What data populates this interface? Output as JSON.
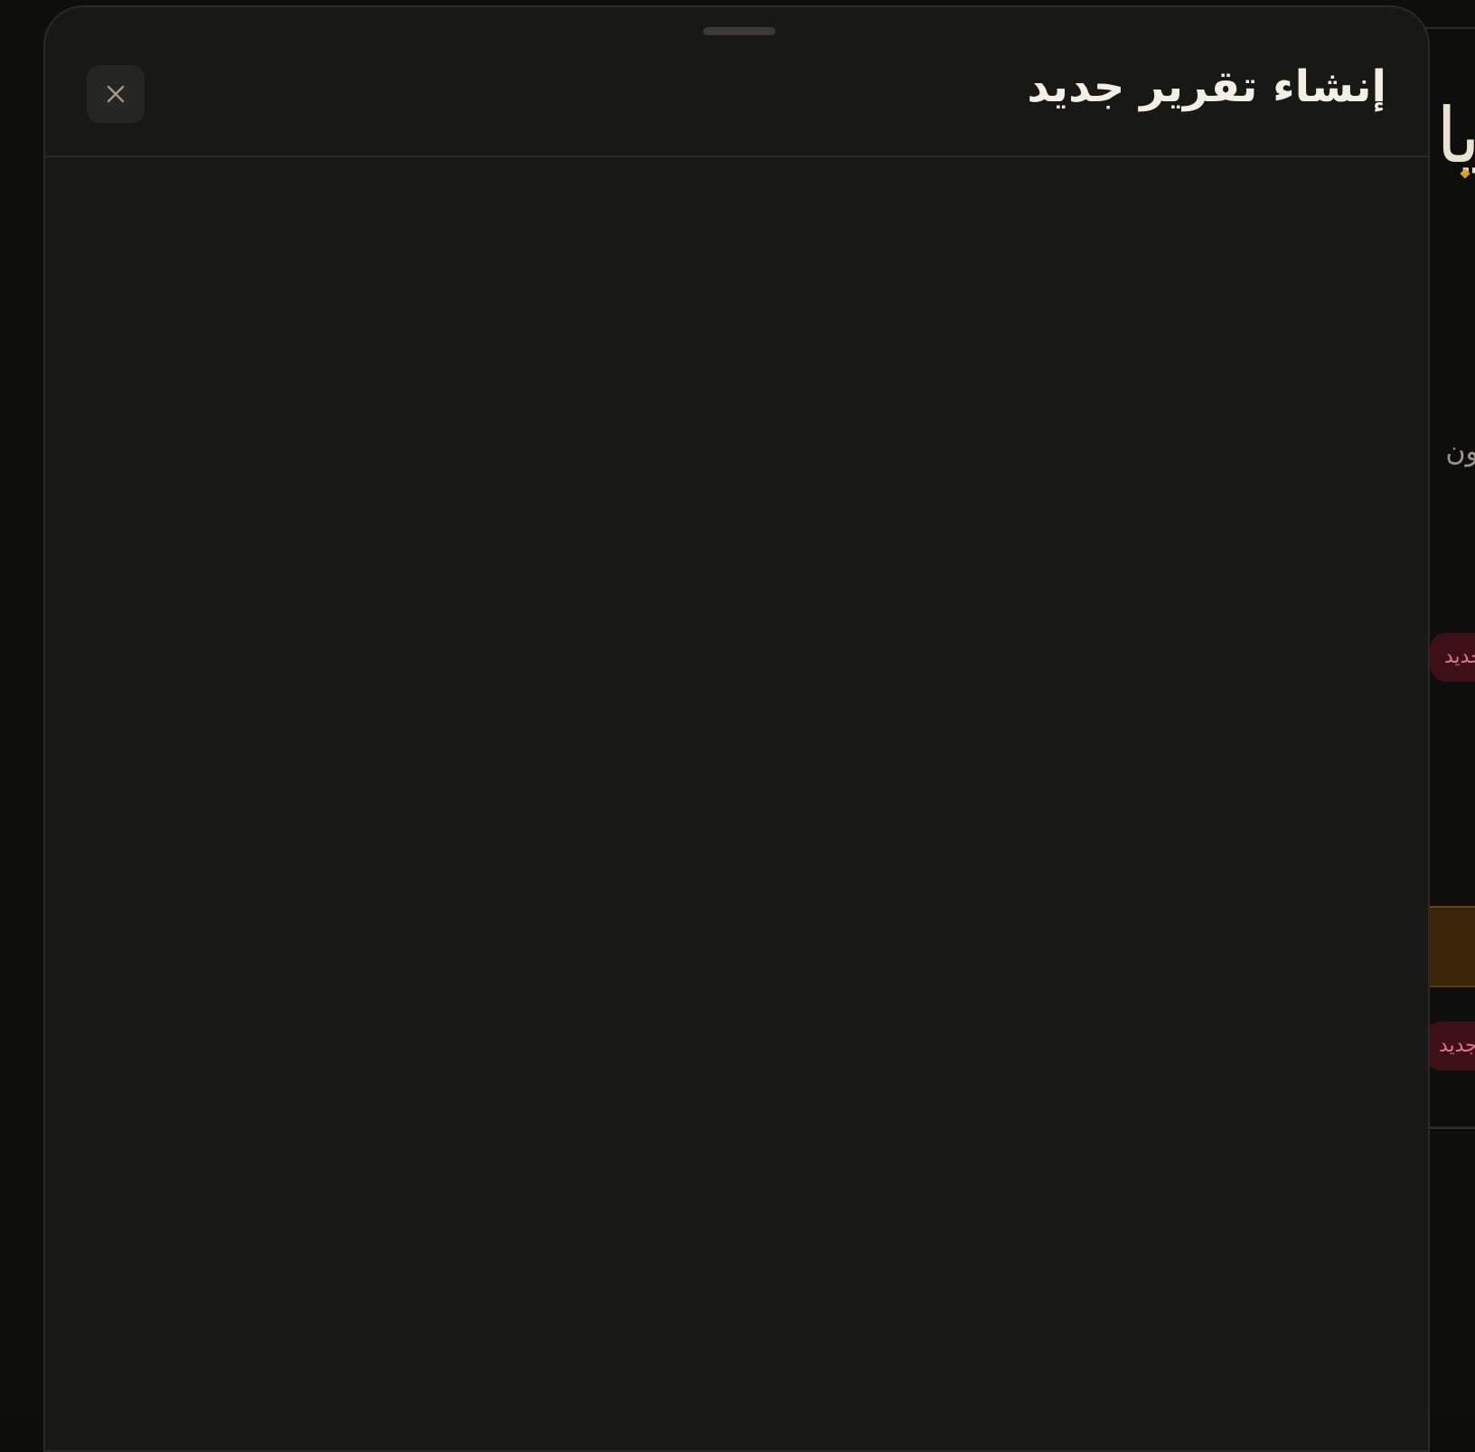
{
  "sheet": {
    "title": "إنشاء تقرير جديد",
    "close_icon": "close-icon"
  },
  "background": {
    "brand_fragment": "يا",
    "text_fragment": "ون",
    "badges": [
      "جديد",
      "جديد"
    ]
  },
  "colors": {
    "sheet_bg": "#181815",
    "page_bg": "#0e0e0d",
    "title": "#f3efe4",
    "badge_bg": "#3d0f17",
    "badge_text": "#e0768a",
    "accent_amber": "#e0a020"
  }
}
